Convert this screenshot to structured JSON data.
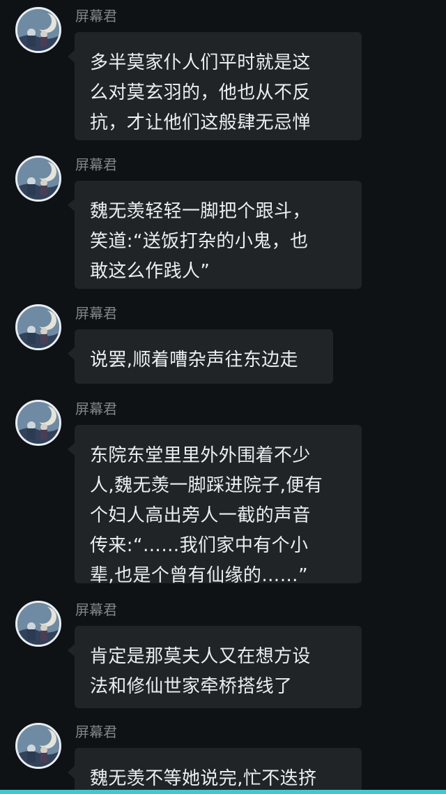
{
  "chat": {
    "messages": [
      {
        "sender": "屏幕君",
        "text": "多半莫家仆人们平时就是这\n么对莫玄羽的，他也从不反\n抗，才让他们这般肆无忌惮"
      },
      {
        "sender": "屏幕君",
        "text": "魏无羡轻轻一脚把个跟斗，\n笑道:“送饭打杂的小鬼，也\n敢这么作践人”"
      },
      {
        "sender": "屏幕君",
        "text": "说罢,顺着嘈杂声往东边走"
      },
      {
        "sender": "屏幕君",
        "text": "东院东堂里里外外围着不少\n人,魏无羡一脚踩进院子,便有\n个妇人高出旁人一截的声音\n传来:“……我们家中有个小\n辈,也是个曾有仙缘的……”"
      },
      {
        "sender": "屏幕君",
        "text": "肯定是那莫夫人又在想方设\n法和修仙世家牵桥搭线了"
      },
      {
        "sender": "屏幕君",
        "text": "魏无羡不等她说完,忙不迭挤"
      }
    ]
  },
  "theme": {
    "background": "#0f1214",
    "bubble": "#202427",
    "text": "#ecefef",
    "sender": "#7f8589",
    "accent_bar": "#41c9d3"
  }
}
